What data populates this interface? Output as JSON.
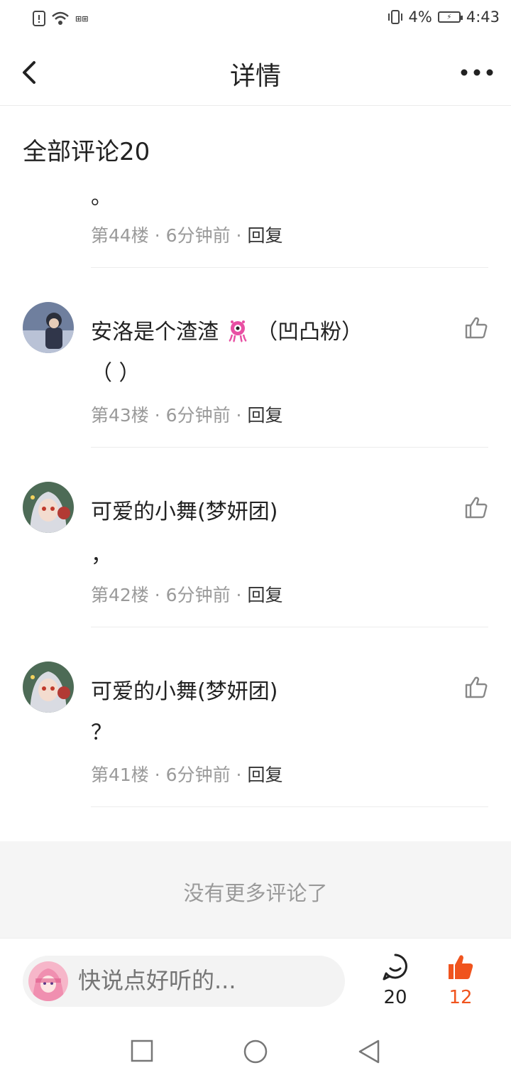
{
  "status_bar": {
    "carrier": "⊞⊞",
    "battery_percent": "4%",
    "time": "4:43"
  },
  "header": {
    "title": "详情"
  },
  "section": {
    "title": "全部评论20"
  },
  "comments": [
    {
      "text": "。",
      "floor": "第44楼",
      "time": "6分钟前",
      "reply": "回复"
    },
    {
      "username": "安洛是个渣渣",
      "badge": "（凹凸粉）",
      "text": "（ ）",
      "floor": "第43楼",
      "time": "6分钟前",
      "reply": "回复"
    },
    {
      "username": "可爱的小舞(梦妍团)",
      "text": "，",
      "floor": "第42楼",
      "time": "6分钟前",
      "reply": "回复"
    },
    {
      "username": "可爱的小舞(梦妍团)",
      "text": "？",
      "floor": "第41楼",
      "time": "6分钟前",
      "reply": "回复"
    }
  ],
  "meta_separator": "·",
  "no_more": "没有更多评论了",
  "bottom_bar": {
    "input_placeholder": "快说点好听的...",
    "comment_count": "20",
    "like_count": "12"
  },
  "colors": {
    "accent": "#f0541e",
    "muted": "#9a9a9a",
    "text": "#222222"
  },
  "icons": [
    "back-icon",
    "more-icon",
    "like-icon",
    "comment-icon",
    "thumbs-up-filled-icon",
    "square-nav-icon",
    "circle-nav-icon",
    "triangle-back-nav-icon"
  ]
}
